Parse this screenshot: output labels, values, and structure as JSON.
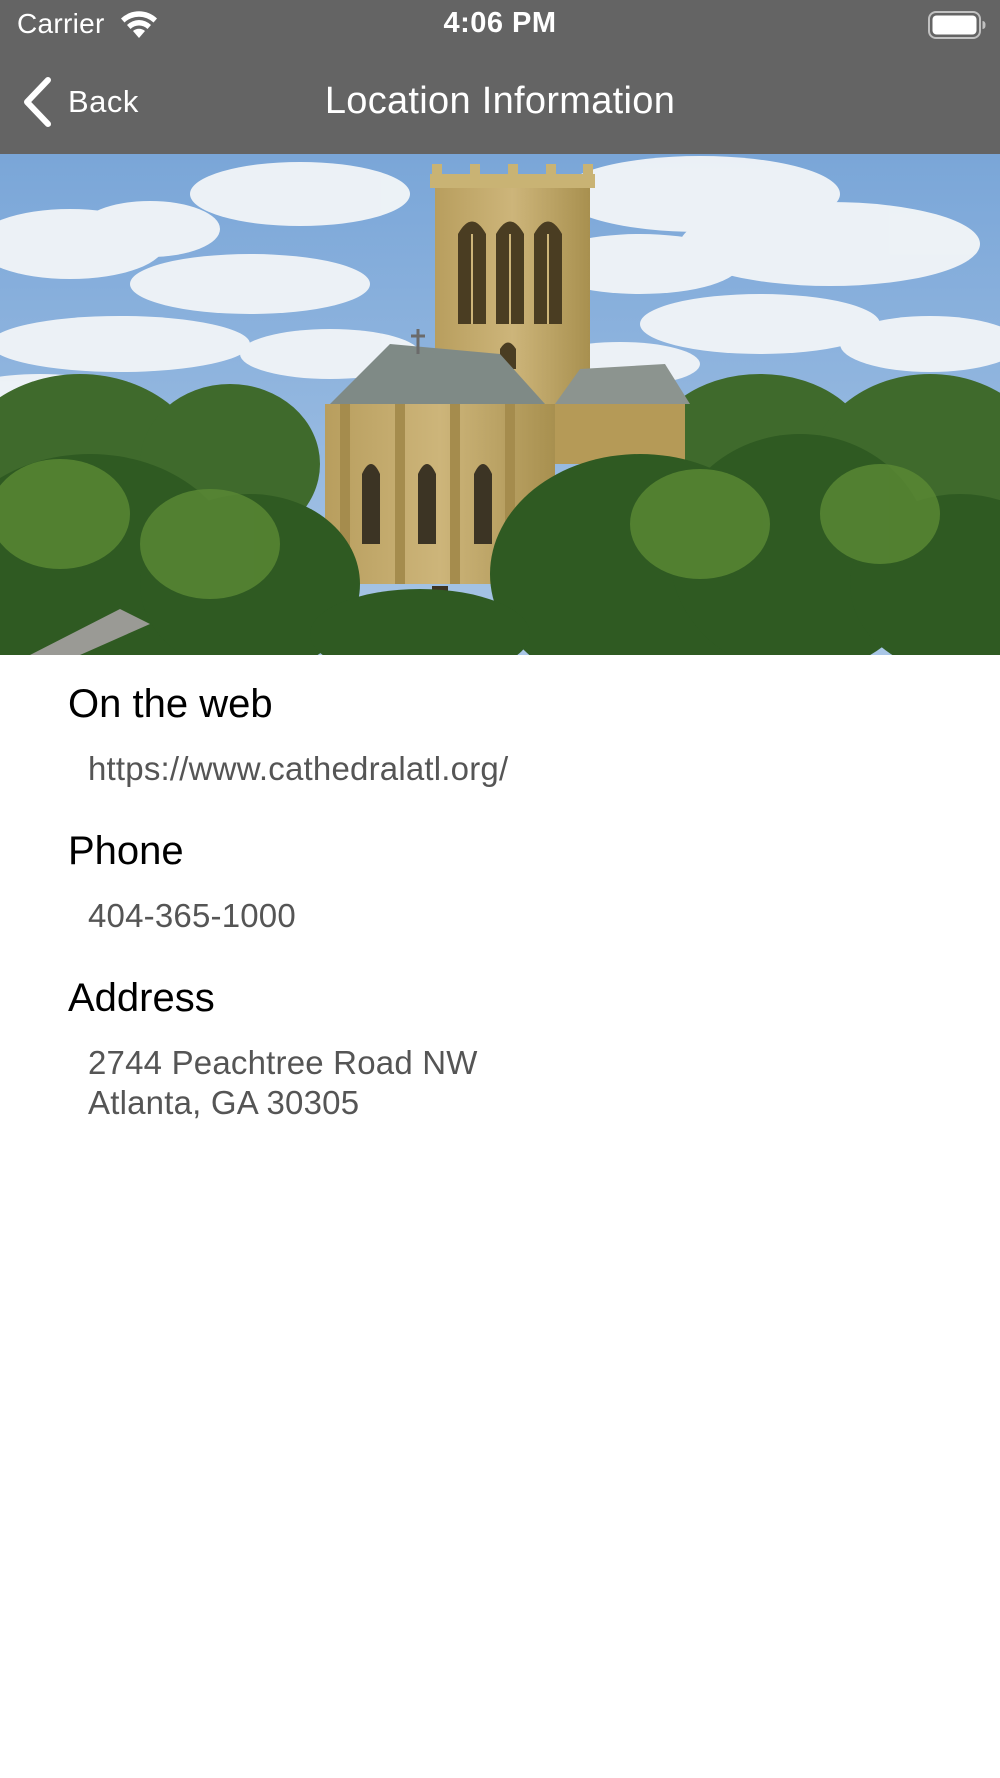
{
  "status_bar": {
    "carrier": "Carrier",
    "time": "4:06 PM",
    "wifi_icon": "wifi-icon",
    "battery_icon": "battery-icon"
  },
  "nav": {
    "back_label": "Back",
    "back_icon": "chevron-left-icon",
    "title": "Location Information"
  },
  "hero_image": {
    "description_icon": "cathedral-photo"
  },
  "sections": {
    "web": {
      "heading": "On the web",
      "value": "https://www.cathedralatl.org/"
    },
    "phone": {
      "heading": "Phone",
      "value": "404-365-1000"
    },
    "address": {
      "heading": "Address",
      "line1": "2744 Peachtree Road NW",
      "line2": "Atlanta, GA 30305"
    }
  },
  "colors": {
    "nav_background": "#646464",
    "heading_text": "#000000",
    "value_text": "#555555"
  }
}
